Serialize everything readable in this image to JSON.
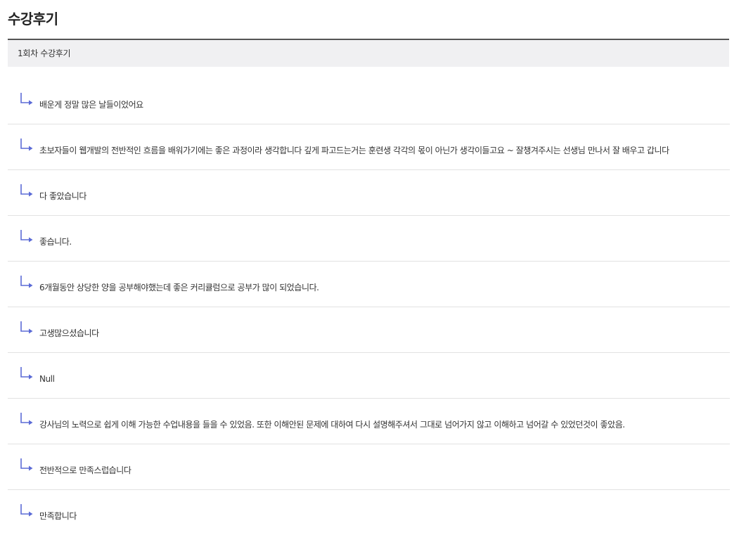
{
  "page": {
    "title": "수강후기"
  },
  "section": {
    "header_label": "1회차 수강후기"
  },
  "colors": {
    "accent_icon": "#5b6bd6",
    "header_bg": "#f0f0f2",
    "header_border": "#555555"
  },
  "reviews": [
    {
      "icon": "reply-arrow-icon",
      "text": "배운게 정말 많은 날들이었어요"
    },
    {
      "icon": "reply-arrow-icon",
      "text": "초보자들이 웹개발의 전반적인 흐름을 배워가기에는 좋은 과정이라 생각합니다 깊게 파고드는거는 훈련생 각각의 몫이 아닌가 생각이들고요 ~ 잘챙겨주시는 선생님 만나서 잘 배우고 갑니다"
    },
    {
      "icon": "reply-arrow-icon",
      "text": "다 좋았습니다"
    },
    {
      "icon": "reply-arrow-icon",
      "text": "좋습니다."
    },
    {
      "icon": "reply-arrow-icon",
      "text": "6개월동안 상당한 양을 공부해야했는데 좋은 커리큘럼으로 공부가 많이 되었습니다."
    },
    {
      "icon": "reply-arrow-icon",
      "text": "고생많으셨습니다"
    },
    {
      "icon": "reply-arrow-icon",
      "text": "Null"
    },
    {
      "icon": "reply-arrow-icon",
      "text": "강사님의 노력으로 쉽게 이해 가능한 수업내용을 들을 수 있었음. 또한 이해안된 문제에 대하여 다시 설명해주셔서 그대로 넘어가지 않고 이해하고 넘어갈 수 있었던것이 좋았음."
    },
    {
      "icon": "reply-arrow-icon",
      "text": "전반적으로 만족스럽습니다"
    },
    {
      "icon": "reply-arrow-icon",
      "text": "만족합니다"
    }
  ]
}
